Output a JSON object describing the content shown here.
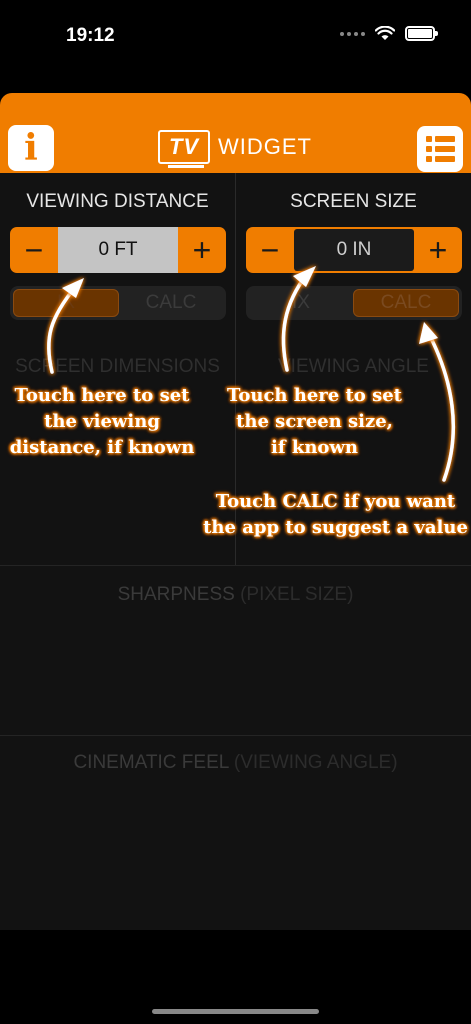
{
  "status_bar": {
    "time": "19:12"
  },
  "header": {
    "logo_tv": "TV",
    "logo_word": "WIDGET"
  },
  "panels": {
    "viewing_distance": {
      "title": "VIEWING DISTANCE",
      "value": "0 FT",
      "minus": "−",
      "plus": "+",
      "segments": [
        "FIX",
        "CALC"
      ],
      "segment_visible": [
        "IX",
        "CALC"
      ],
      "selected": "FIX"
    },
    "screen_size": {
      "title": "SCREEN SIZE",
      "value": "0 IN",
      "minus": "−",
      "plus": "+",
      "segments": [
        "FIX",
        "CALC"
      ],
      "segment_visible": [
        "IX",
        "CALC"
      ],
      "selected": "CALC"
    }
  },
  "sections": {
    "screen_dimensions": "SCREEN DIMENSIONS",
    "viewing_angle": "VIEWING ANGLE",
    "sharpness": "SHARPNESS",
    "sharpness_sub": "(PIXEL SIZE)",
    "cinematic": "CINEMATIC FEEL",
    "cinematic_sub": "(VIEWING ANGLE)"
  },
  "callouts": {
    "distance": [
      "Touch here to set",
      "the viewing",
      "distance, if known"
    ],
    "screen": [
      "Touch here to set",
      "the screen size,",
      "if known"
    ],
    "calc": [
      "Touch CALC if you want",
      "the app to suggest a value"
    ]
  },
  "colors": {
    "accent": "#f07d00",
    "background": "#121212"
  },
  "icons": [
    "info-icon",
    "list-icon",
    "wifi-icon",
    "battery-icon",
    "signal-icon"
  ]
}
